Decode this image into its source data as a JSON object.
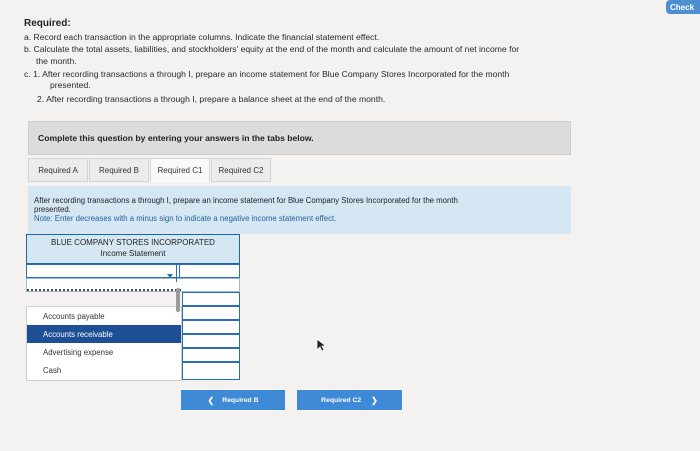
{
  "top_button": {
    "label": "Check"
  },
  "required": {
    "title": "Required:",
    "a": "a. Record each transaction in the appropriate columns. Indicate the financial statement effect.",
    "b_line1": "b. Calculate the total assets, liabilities, and stockholders' equity at the end of the month and calculate the amount of net income for",
    "b_line2": "the month.",
    "c1_line1": "c. 1. After recording transactions a through I, prepare an income statement for Blue Company Stores Incorporated for the month",
    "c1_line2": "presented.",
    "c2": "2. After recording transactions a through I, prepare a balance sheet at the end of the month."
  },
  "instructions": "Complete this question by entering your answers in the tabs below.",
  "tabs": [
    {
      "label": "Required A"
    },
    {
      "label": "Required B"
    },
    {
      "label": "Required C1"
    },
    {
      "label": "Required C2"
    }
  ],
  "panel": {
    "text_line1": "After recording transactions a through I, prepare an income statement for Blue Company Stores Incorporated for the month",
    "text_line2": "presented.",
    "note": "Note: Enter decreases with a minus sign to indicate a negative income statement effect."
  },
  "statement": {
    "company": "BLUE COMPANY STORES INCORPORATED",
    "title": "Income Statement"
  },
  "dropdown": {
    "options": [
      {
        "label": "Accounts payable"
      },
      {
        "label": "Accounts receivable"
      },
      {
        "label": "Advertising expense"
      },
      {
        "label": "Cash"
      }
    ],
    "selected_index": 1
  },
  "nav": {
    "prev_label": "Required B",
    "next_label": "Required C2"
  },
  "colors": {
    "accent": "#3e8ad7",
    "panel": "#d6e7f4",
    "selected": "#1c4f94"
  }
}
